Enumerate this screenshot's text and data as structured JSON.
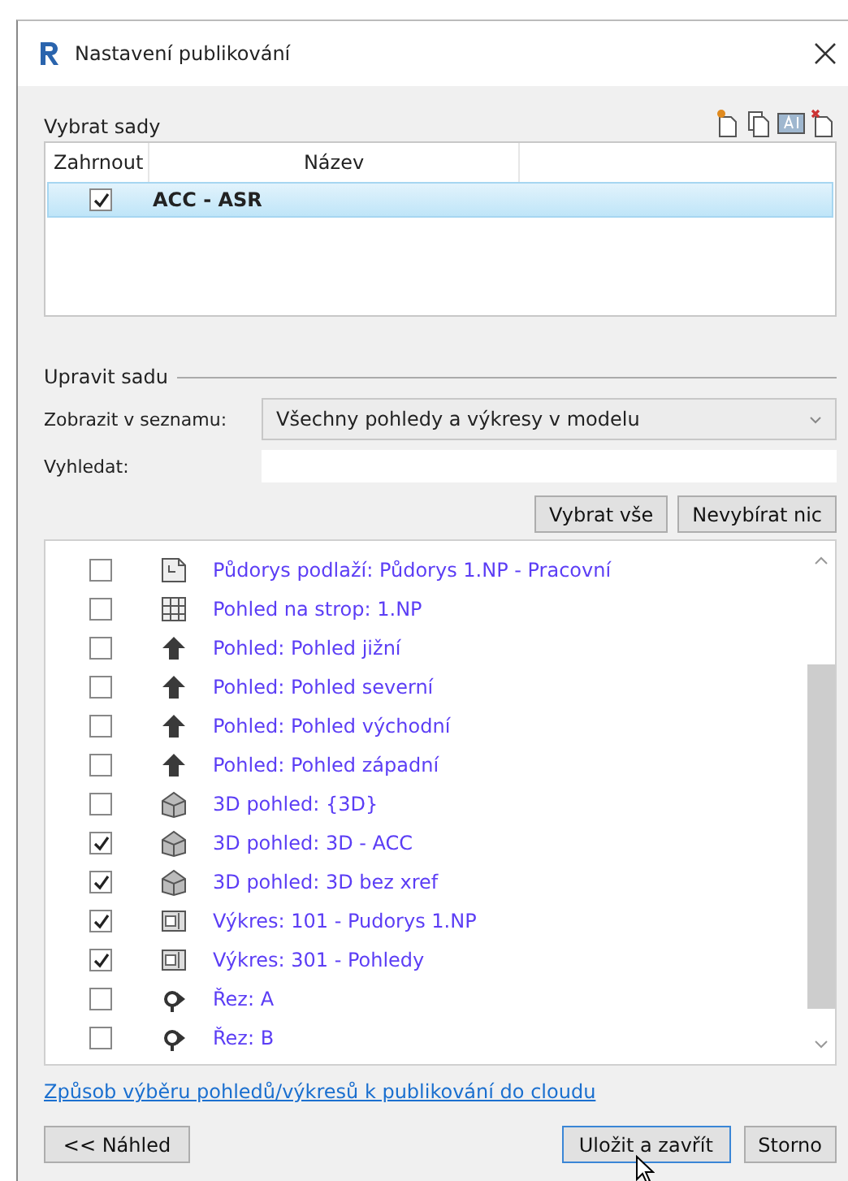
{
  "window": {
    "title": "Nastavení publikování"
  },
  "sets": {
    "label": "Vybrat sady",
    "columns": [
      "Zahrnout",
      "Název"
    ],
    "rows": [
      {
        "name": "ACC - ASR",
        "checked": true,
        "selected": true
      }
    ]
  },
  "edit": {
    "label": "Upravit sadu",
    "show_label": "Zobrazit v seznamu:",
    "show_value": "Všechny pohledy a výkresy v modelu",
    "search_label": "Vyhledat:",
    "buttons": [
      "Vybrat vše",
      "Nevybírat nic"
    ]
  },
  "views": [
    {
      "kind": "floorplan",
      "name": "Půdorys podlaží: Půdorys 1.NP - Pracovní",
      "checked": false
    },
    {
      "kind": "ceiling",
      "name": "Pohled na strop: 1.NP",
      "checked": false
    },
    {
      "kind": "elevation",
      "name": "Pohled: Pohled jižní",
      "checked": false
    },
    {
      "kind": "elevation",
      "name": "Pohled: Pohled severní",
      "checked": false
    },
    {
      "kind": "elevation",
      "name": "Pohled: Pohled východní",
      "checked": false
    },
    {
      "kind": "elevation",
      "name": "Pohled: Pohled západní",
      "checked": false
    },
    {
      "kind": "model",
      "name": "3D pohled: {3D}",
      "checked": false
    },
    {
      "kind": "model",
      "name": "3D pohled: 3D - ACC",
      "checked": true
    },
    {
      "kind": "model",
      "name": "3D pohled: 3D bez xref",
      "checked": true
    },
    {
      "kind": "sheet",
      "name": "Výkres: 101 - Pudorys 1.NP",
      "checked": true
    },
    {
      "kind": "sheet",
      "name": "Výkres: 301 - Pohledy",
      "checked": true
    },
    {
      "kind": "section",
      "name": "Řez: A",
      "checked": false
    },
    {
      "kind": "section",
      "name": "Řez: B",
      "checked": false
    }
  ],
  "link": "Způsob výběru pohledů/výkresů k publikování do cloudu",
  "footer": {
    "preview": "<< Náhled",
    "save": "Uložit a zavřít",
    "cancel": "Storno"
  }
}
